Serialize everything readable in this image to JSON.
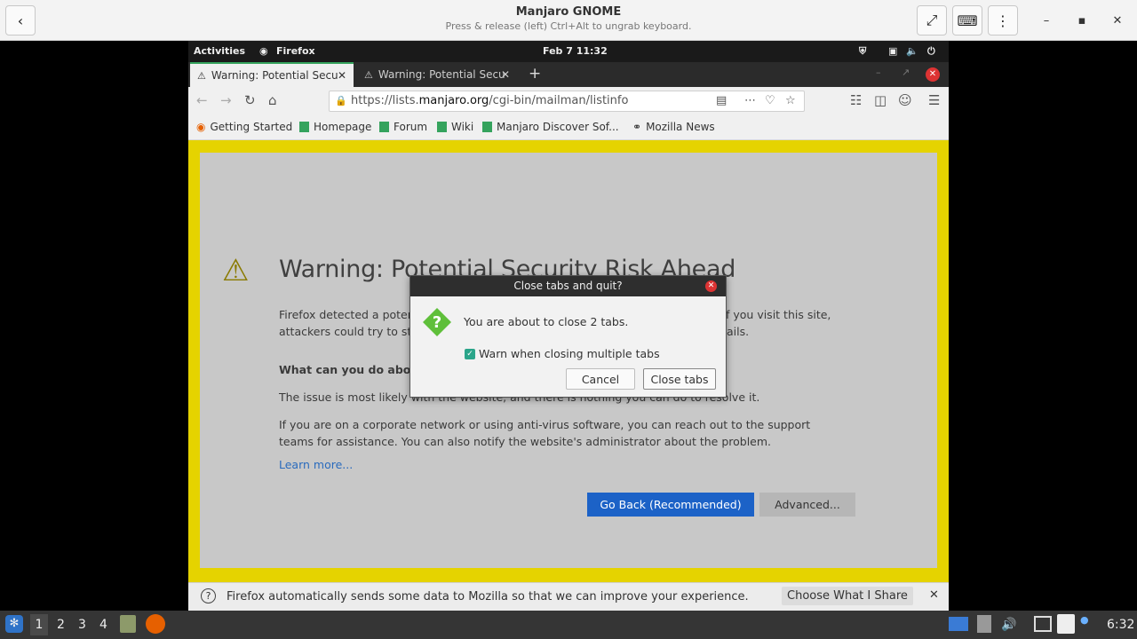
{
  "viewer": {
    "title": "Manjaro GNOME",
    "subtitle": "Press & release (left) Ctrl+Alt to ungrab keyboard."
  },
  "gnome": {
    "activities": "Activities",
    "app": "Firefox",
    "clock": "Feb 7  11:32"
  },
  "tabs": [
    {
      "label": "Warning: Potential Secu"
    },
    {
      "label": "Warning: Potential Secu"
    }
  ],
  "url": {
    "prefix": "https://lists.",
    "domain": "manjaro.org",
    "path": "/cgi-bin/mailman/listinfo"
  },
  "bookmarks": [
    "Getting Started",
    "Homepage",
    "Forum",
    "Wiki",
    "Manjaro Discover Sof...",
    "Mozilla News"
  ],
  "page": {
    "title": "Warning: Potential Security Risk Ahead",
    "para1_line1": "Firefox detected a potent",
    "para1_line1_end": "f you visit this site,",
    "para1_line2": "attackers could try to stea",
    "para1_line2_end": "ails.",
    "heading": "What can you do about",
    "para2": "The issue is most likely with the website, and there is nothing you can do to resolve it.",
    "para3": "If you are on a corporate network or using anti-virus software, you can reach out to the support teams for assistance. You can also notify the website's administrator about the problem.",
    "learn_more": "Learn more...",
    "go_back": "Go Back (Recommended)",
    "advanced": "Advanced..."
  },
  "notice": {
    "text": "Firefox automatically sends some data to Mozilla so that we can improve your experience.",
    "button": "Choose What I Share"
  },
  "dialog": {
    "title": "Close tabs and quit?",
    "message": "You are about to close 2 tabs.",
    "checkbox": "Warn when closing multiple tabs",
    "checked": true,
    "cancel": "Cancel",
    "confirm": "Close tabs"
  },
  "taskbar": {
    "workspaces": [
      "1",
      "2",
      "3",
      "4"
    ],
    "time": "6:32"
  },
  "colors": {
    "accent_green": "#35a35d",
    "warning_yellow": "#e5d300",
    "primary_blue": "#1c62c7"
  }
}
